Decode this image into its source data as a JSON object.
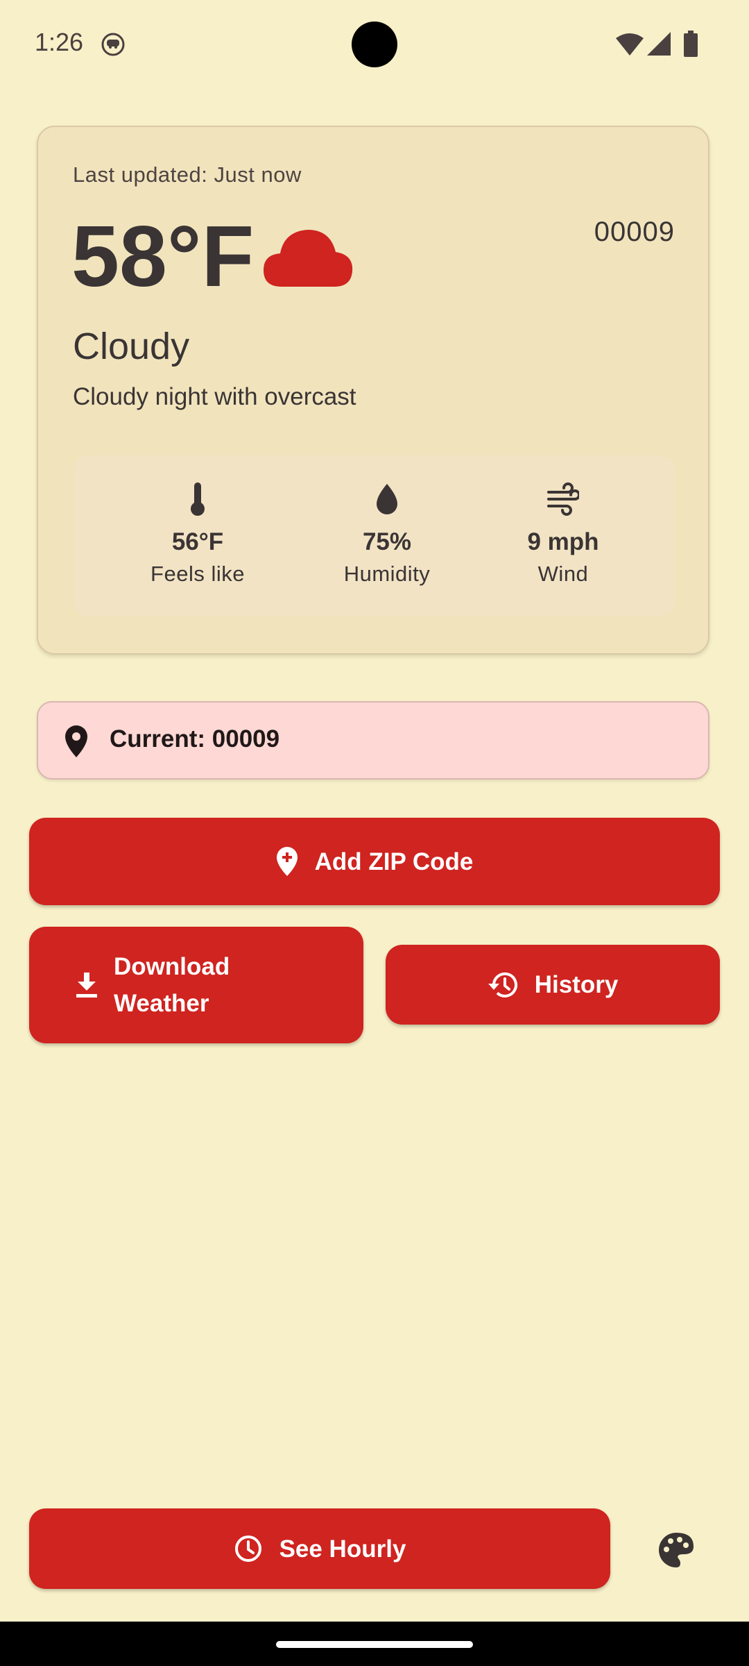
{
  "status_bar": {
    "time": "1:26"
  },
  "weather_card": {
    "last_updated": "Last updated: Just now",
    "temperature": "58°F",
    "zip": "00009",
    "condition": "Cloudy",
    "description": "Cloudy night with overcast",
    "condition_icon": "cloud-icon",
    "stats": {
      "feels_like": {
        "value": "56°F",
        "label": "Feels like",
        "icon": "thermometer-icon"
      },
      "humidity": {
        "value": "75%",
        "label": "Humidity",
        "icon": "water-drop-icon"
      },
      "wind": {
        "value": "9 mph",
        "label": "Wind",
        "icon": "wind-icon"
      }
    }
  },
  "current_location": {
    "label": "Current: 00009",
    "icon": "location-pin-icon"
  },
  "buttons": {
    "add_zip": "Add ZIP Code",
    "download_line1": "Download",
    "download_line2": "Weather",
    "history": "History",
    "see_hourly": "See Hourly"
  },
  "colors": {
    "background": "#f8f0c8",
    "card": "#f1e4bd",
    "accent": "#cf2420",
    "current_bar": "#fdd8d4",
    "text": "#3a3434"
  }
}
